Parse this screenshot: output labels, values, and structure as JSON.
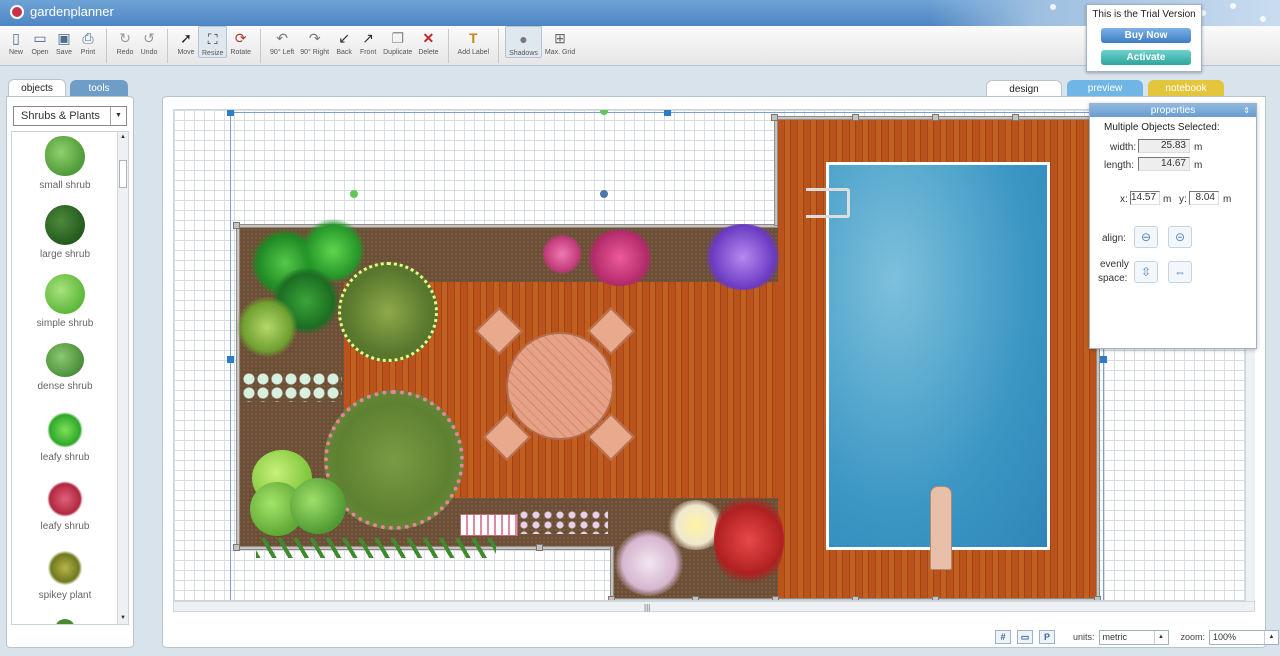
{
  "app": {
    "name": "gardenplanner"
  },
  "toolbar": {
    "buttons": [
      {
        "label": "New",
        "icon": "new-document-icon"
      },
      {
        "label": "Open",
        "icon": "folder-open-icon"
      },
      {
        "label": "Save",
        "icon": "save-disk-icon"
      },
      {
        "label": "Print",
        "icon": "print-icon"
      },
      {
        "label": "Redo",
        "icon": "redo-icon"
      },
      {
        "label": "Undo",
        "icon": "undo-icon"
      },
      {
        "label": "Move",
        "icon": "arrow-cursor-icon"
      },
      {
        "label": "Resize",
        "icon": "resize-icon"
      },
      {
        "label": "Rotate",
        "icon": "rotate-icon"
      },
      {
        "label": "90° Left",
        "icon": "rotate-left-icon"
      },
      {
        "label": "90° Right",
        "icon": "rotate-right-icon"
      },
      {
        "label": "Back",
        "icon": "send-back-icon"
      },
      {
        "label": "Front",
        "icon": "bring-front-icon"
      },
      {
        "label": "Duplicate",
        "icon": "duplicate-icon"
      },
      {
        "label": "Delete",
        "icon": "delete-x-icon"
      },
      {
        "label": "Add Label",
        "icon": "text-label-icon"
      },
      {
        "label": "Shadows",
        "icon": "shadows-icon"
      },
      {
        "label": "Max. Grid",
        "icon": "grid-icon"
      }
    ]
  },
  "trial": {
    "message": "This is the Trial Version",
    "buy_label": "Buy Now",
    "activate_label": "Activate"
  },
  "left_tabs": {
    "objects": "objects",
    "tools": "tools"
  },
  "category": {
    "selected": "Shrubs & Plants"
  },
  "objects": [
    {
      "name": "small shrub",
      "color": "#4f9a3a"
    },
    {
      "name": "large shrub",
      "color": "#245a1f"
    },
    {
      "name": "simple shrub",
      "color": "#5db83a"
    },
    {
      "name": "dense shrub",
      "color": "#4b8f3b"
    },
    {
      "name": "leafy shrub",
      "color": "#2fa82b"
    },
    {
      "name": "leafy shrub",
      "color": "#b0283f"
    },
    {
      "name": "spikey plant",
      "color": "#6e7a1e"
    }
  ],
  "right_tabs": {
    "design": "design",
    "preview": "preview",
    "notebook": "notebook"
  },
  "properties": {
    "title": "properties",
    "selection": "Multiple Objects Selected:",
    "width_label": "width:",
    "width_value": "25.83",
    "length_label": "length:",
    "length_value": "14.67",
    "unit": "m",
    "x_label": "x:",
    "x_value": "14.57",
    "y_label": "y:",
    "y_value": "8.04",
    "align_label": "align:",
    "evenly_label": "evenly",
    "space_label": "space:"
  },
  "status": {
    "units_label": "units:",
    "units_value": "metric",
    "zoom_label": "zoom:",
    "zoom_value": "100%",
    "p_label": "P"
  }
}
